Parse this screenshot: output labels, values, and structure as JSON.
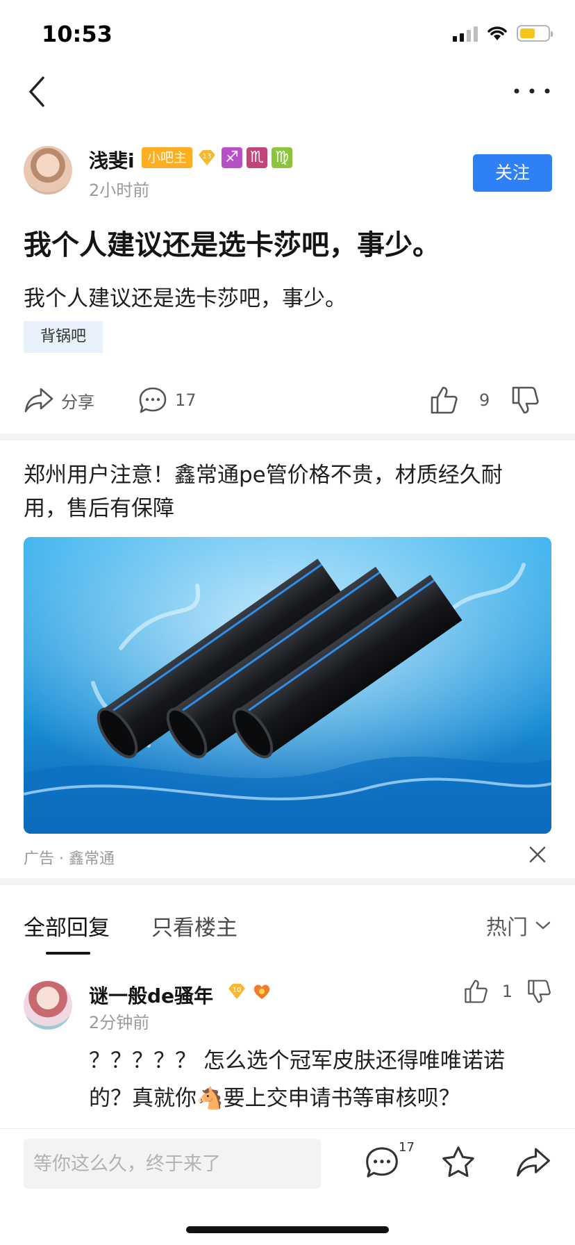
{
  "status_bar": {
    "time": "10:53",
    "battery_color": "#f5c518"
  },
  "nav": {
    "back_icon": "chevron-left-icon",
    "more_icon": "more-dots-icon"
  },
  "author": {
    "name": "浅斐i",
    "badge_bazhu": "小吧主",
    "level": "13",
    "zodiac": [
      {
        "glyph": "♐",
        "color": "#b84fc9"
      },
      {
        "glyph": "♏",
        "color": "#c2447a"
      },
      {
        "glyph": "♍",
        "color": "#8cc43c"
      }
    ],
    "time": "2小时前",
    "follow_label": "关注"
  },
  "post": {
    "title": "我个人建议还是选卡莎吧，事少。",
    "body": "我个人建议还是选卡莎吧，事少。",
    "tag": "背锅吧"
  },
  "actions": {
    "share_label": "分享",
    "comment_count": "17",
    "like_count": "9"
  },
  "ad": {
    "title": "郑州用户注意！鑫常通pe管价格不贵，材质经久耐用，售后有保障",
    "source": "广告 · 鑫常通"
  },
  "reply_tabs": {
    "all": "全部回复",
    "owner_only": "只看楼主",
    "sort": "热门"
  },
  "comment": {
    "name": "谜一般de骚年",
    "level": "10",
    "time": "2分钟前",
    "like_count": "1",
    "text": "？？？？？ 怎么选个冠军皮肤还得唯唯诺诺的？真就你🐴要上交申请书等审核呗？"
  },
  "bottom_bar": {
    "input_placeholder": "等你这么久，终于来了",
    "comment_count": "17"
  },
  "accent_color": "#2f7ff5"
}
